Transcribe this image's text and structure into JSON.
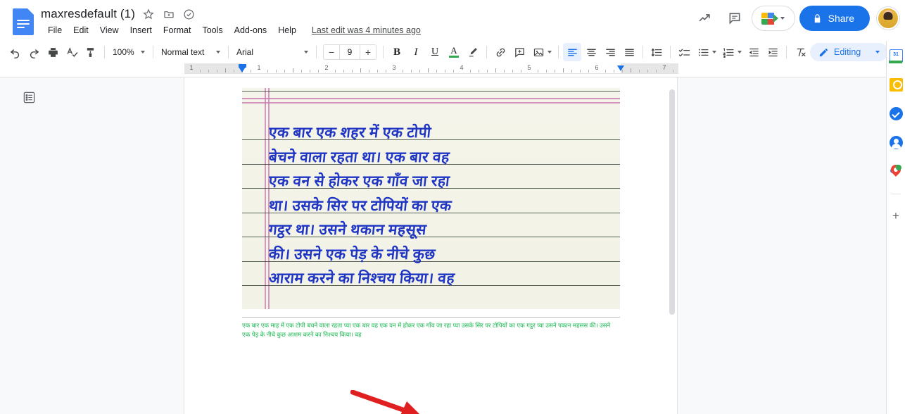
{
  "header": {
    "doc_title": "maxresdefault (1)",
    "logo_name": "google-docs-logo",
    "title_icons": [
      {
        "name": "star-icon",
        "label": "Star"
      },
      {
        "name": "move-to-folder-icon",
        "label": "Move"
      },
      {
        "name": "cloud-saved-icon",
        "label": "Saved to Drive"
      }
    ],
    "menus": [
      "File",
      "Edit",
      "View",
      "Insert",
      "Format",
      "Tools",
      "Add-ons",
      "Help"
    ],
    "last_edit": "Last edit was 4 minutes ago",
    "activity_icon": "activity-dashboard-icon",
    "comment_icon": "comment-history-icon",
    "meet_label": "",
    "share_label": "Share",
    "share_lock_icon": "lock-icon",
    "avatar_name": "user-avatar",
    "accent_color": "#1a73e8"
  },
  "toolbar": {
    "undo": "undo-icon",
    "redo": "redo-icon",
    "print": "print-icon",
    "spellcheck": "spellcheck-icon",
    "paint_format": "paint-format-icon",
    "zoom_value": "100%",
    "style_value": "Normal text",
    "font_value": "Arial",
    "font_size_value": "9",
    "font_size_minus": "−",
    "font_size_plus": "+",
    "bold": "B",
    "italic": "I",
    "underline": "U",
    "text_color_letter": "A",
    "text_color_swatch": "#34a853",
    "highlight": "highlight-pen-icon",
    "link": "insert-link-icon",
    "comment": "add-comment-icon",
    "image": "insert-image-icon",
    "align_left": "align-left-icon",
    "align_center": "align-center-icon",
    "align_right": "align-right-icon",
    "align_justify": "align-justify-icon",
    "line_spacing": "line-spacing-icon",
    "checklist": "checklist-icon",
    "bulleted_list": "bulleted-list-icon",
    "numbered_list": "numbered-list-icon",
    "decrease_indent": "decrease-indent-icon",
    "increase_indent": "increase-indent-icon",
    "clear_formatting": "clear-formatting-icon",
    "mode_label": "Editing",
    "mode_icon": "pencil-icon",
    "collapse_icon": "chevron-up-icon"
  },
  "ruler": {
    "numbers": [
      "1",
      "1",
      "2",
      "3",
      "4",
      "5",
      "6",
      "7"
    ],
    "left_indent_marker": "left-indent-marker",
    "right_indent_marker": "right-indent-marker"
  },
  "canvas": {
    "outline_icon": "document-outline-icon",
    "image": {
      "name": "handwritten-hindi-notebook-image",
      "handwriting_lines": [
        "एक बार एक शहर में एक टोपी",
        "बेचने वाला रहता था। एक बार वह",
        "एक वन से होकर एक गाँव जा रहा",
        "था। उसके सिर पर टोपियों का एक",
        "गट्ठर था। उसने थकान महसूस",
        "की। उसने एक पेड़ के नीचे कुछ",
        "आराम करने का निश्चय किया। वह"
      ],
      "ink_color": "#1f35c4",
      "paper_color": "#f3f3e8",
      "margin_line_color": "#c77ab0"
    },
    "transcription": {
      "name": "ocr-transcription-text",
      "color": "#1db954",
      "text": "एक बार एक माह में एक टोपी बचने वाला रहता प्या एक बार वह एक वन में होकर एक गाँव जा रहा प्या उसके सिर पर टोपियों का एक गट्ठर प्या उसने पकान महसस की। उसने एक पेड़ के नीचे कुछ आशम करने का निश्चय किया। वह"
    },
    "annotation_arrow": {
      "name": "red-annotation-arrow",
      "color": "#e02020"
    }
  },
  "sidepanel": {
    "items": [
      {
        "name": "google-calendar-icon",
        "label": "Calendar"
      },
      {
        "name": "google-keep-icon",
        "label": "Keep"
      },
      {
        "name": "google-tasks-icon",
        "label": "Tasks"
      },
      {
        "name": "google-contacts-icon",
        "label": "Contacts"
      },
      {
        "name": "google-maps-icon",
        "label": "Maps"
      }
    ],
    "add_label": "+"
  }
}
